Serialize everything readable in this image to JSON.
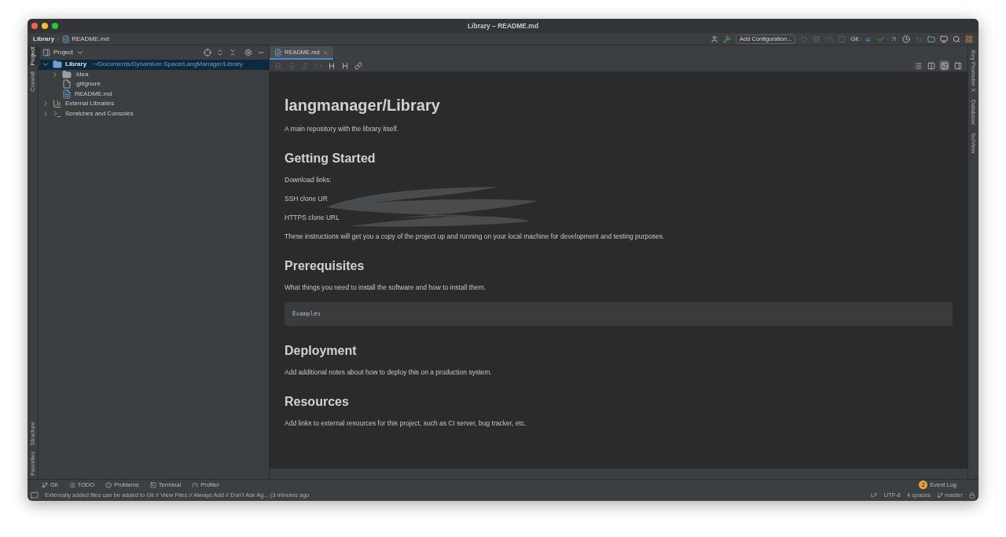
{
  "window": {
    "title": "Library – README.md"
  },
  "breadcrumbs": [
    {
      "label": "Library",
      "kind": "module"
    },
    {
      "label": "README.md",
      "kind": "file"
    }
  ],
  "toolbar": {
    "add_configuration": "Add Configuration...",
    "git_label": "Git:"
  },
  "left_strip": {
    "top": [
      {
        "label": "Project",
        "selected": true
      },
      {
        "label": "Commit",
        "selected": false
      }
    ],
    "bottom": [
      {
        "label": "Structure",
        "selected": false
      },
      {
        "label": "Favorites",
        "selected": false
      }
    ]
  },
  "right_strip": [
    {
      "label": "Key Promoter X"
    },
    {
      "label": "Database"
    },
    {
      "label": "SciView"
    }
  ],
  "project_panel": {
    "title": "Project",
    "tree": [
      {
        "label": "Library",
        "path": "~/Documents/Dynamium Space/LangManager/Library",
        "kind": "module",
        "expanded": true,
        "selected": true,
        "children": [
          {
            "label": ".idea",
            "kind": "folder",
            "expanded": false,
            "selected": false
          },
          {
            "label": ".gitignore",
            "kind": "file",
            "selected": false
          },
          {
            "label": "README.md",
            "kind": "markdown",
            "selected": false
          }
        ]
      },
      {
        "label": "External Libraries",
        "kind": "libraries",
        "expanded": false,
        "selected": false
      },
      {
        "label": "Scratches and Consoles",
        "kind": "scratches",
        "expanded": false,
        "selected": false
      }
    ]
  },
  "editor": {
    "tabs": [
      {
        "label": "README.md",
        "selected": true
      }
    ],
    "view_modes": [
      {
        "selected": false
      },
      {
        "selected": false
      },
      {
        "selected": true
      },
      {
        "selected": false
      }
    ],
    "content": [
      {
        "kind": "h1",
        "text": "langmanager/Library"
      },
      {
        "kind": "p",
        "text": "A main repository with the library itself."
      },
      {
        "kind": "h2",
        "text": "Getting Started"
      },
      {
        "kind": "p",
        "text": "Download links:"
      },
      {
        "kind": "redacted",
        "text": "SSH clone UR"
      },
      {
        "kind": "redacted",
        "text": "HTTPS clone URL"
      },
      {
        "kind": "p",
        "text": "These instructions will get you a copy of the project up and running on your local machine for development and testing purposes."
      },
      {
        "kind": "h2",
        "text": "Prerequisites"
      },
      {
        "kind": "p",
        "text": "What things you need to install the software and how to install them."
      },
      {
        "kind": "code",
        "text": "Examples"
      },
      {
        "kind": "h2",
        "text": "Deployment"
      },
      {
        "kind": "p",
        "text": "Add additional notes about how to deploy this on a production system."
      },
      {
        "kind": "h2",
        "text": "Resources"
      },
      {
        "kind": "p",
        "text": "Add links to external resources for this project, such as CI server, bug tracker, etc."
      }
    ]
  },
  "bottom_tools": [
    {
      "label": "Git",
      "kind": "git"
    },
    {
      "label": "TODO",
      "kind": "todo"
    },
    {
      "label": "Problems",
      "kind": "problems"
    },
    {
      "label": "Terminal",
      "kind": "terminal"
    },
    {
      "label": "Profiler",
      "kind": "profiler"
    }
  ],
  "event_log": {
    "label": "Event Log",
    "count": "2"
  },
  "status_bar": {
    "message": "Externally added files can be added to Git // View Files // Always Add // Don't Ask Ag... (3 minutes ago",
    "items": [
      "LF",
      "UTF-8",
      "4 spaces"
    ],
    "branch": "master"
  }
}
